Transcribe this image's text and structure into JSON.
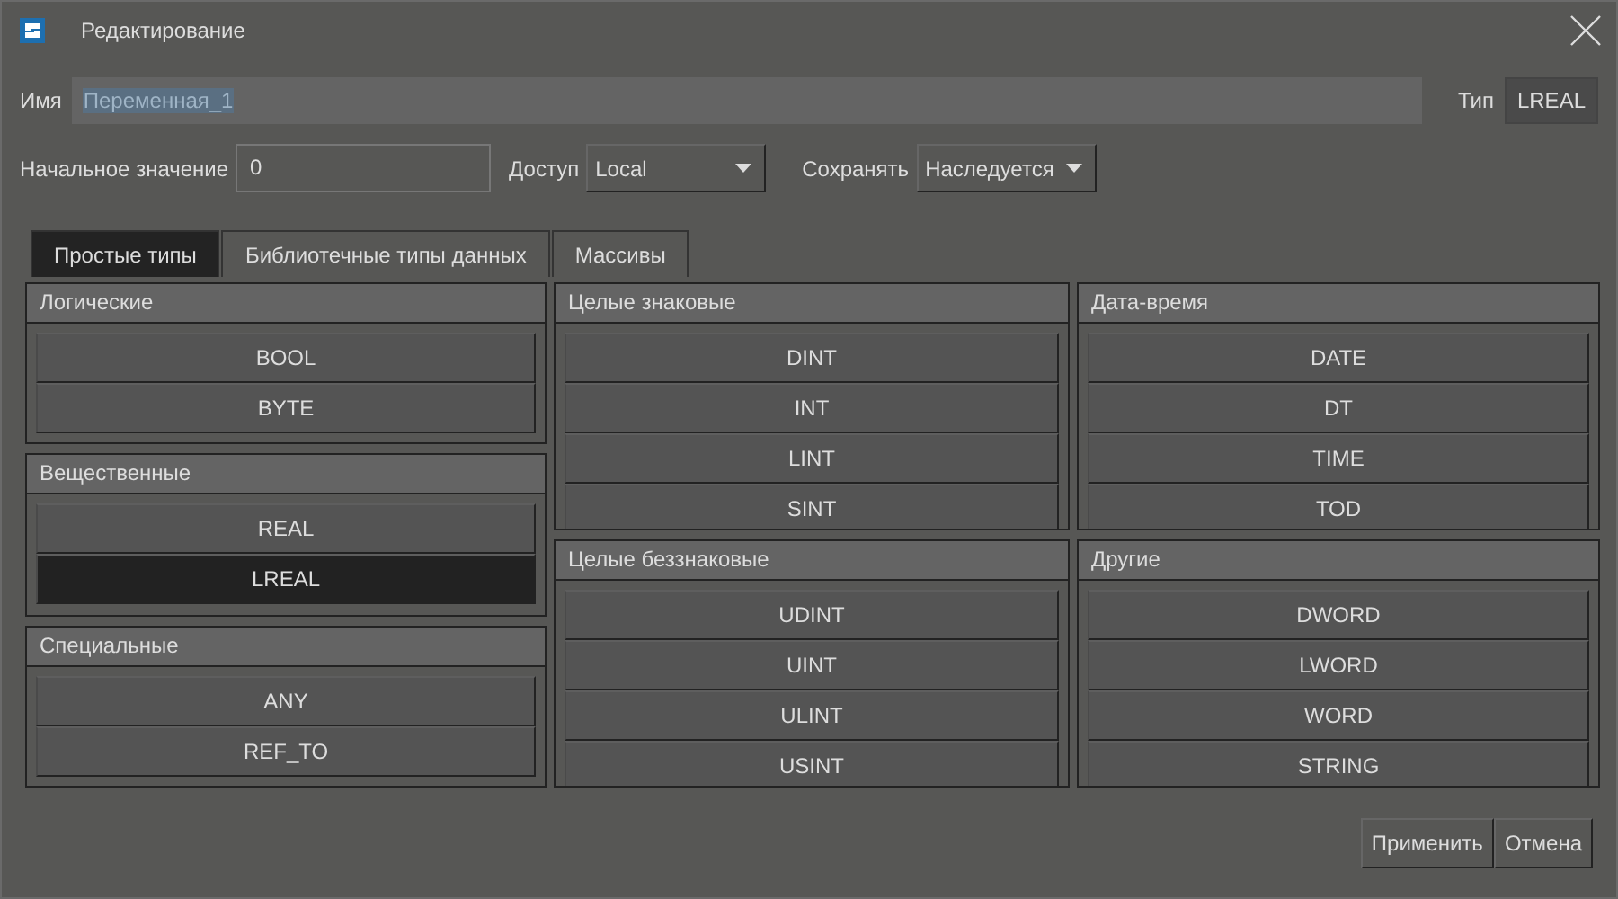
{
  "window": {
    "title": "Редактирование"
  },
  "name": {
    "label": "Имя",
    "value": "Переменная_1",
    "selected_text": true
  },
  "type": {
    "label": "Тип",
    "value": "LREAL"
  },
  "initial_value": {
    "label": "Начальное значение",
    "value": "0"
  },
  "access": {
    "label": "Доступ",
    "value": "Local"
  },
  "retain": {
    "label": "Сохранять",
    "value": "Наследуется"
  },
  "tabs": [
    {
      "label": "Простые типы",
      "selected": true
    },
    {
      "label": "Библиотечные типы данных",
      "selected": false
    },
    {
      "label": "Массивы",
      "selected": false
    }
  ],
  "columns": [
    [
      {
        "title": "Логические",
        "items": [
          {
            "label": "BOOL",
            "selected": false
          },
          {
            "label": "BYTE",
            "selected": false
          }
        ]
      },
      {
        "title": "Вещественные",
        "items": [
          {
            "label": "REAL",
            "selected": false
          },
          {
            "label": "LREAL",
            "selected": true
          }
        ]
      },
      {
        "title": "Специальные",
        "items": [
          {
            "label": "ANY",
            "selected": false
          },
          {
            "label": "REF_TO",
            "selected": false
          }
        ]
      }
    ],
    [
      {
        "title": "Целые знаковые",
        "items": [
          {
            "label": "DINT",
            "selected": false
          },
          {
            "label": "INT",
            "selected": false
          },
          {
            "label": "LINT",
            "selected": false
          },
          {
            "label": "SINT",
            "selected": false
          }
        ]
      },
      {
        "title": "Целые беззнаковые",
        "items": [
          {
            "label": "UDINT",
            "selected": false
          },
          {
            "label": "UINT",
            "selected": false
          },
          {
            "label": "ULINT",
            "selected": false
          },
          {
            "label": "USINT",
            "selected": false
          }
        ]
      }
    ],
    [
      {
        "title": "Дата-время",
        "items": [
          {
            "label": "DATE",
            "selected": false
          },
          {
            "label": "DT",
            "selected": false
          },
          {
            "label": "TIME",
            "selected": false
          },
          {
            "label": "TOD",
            "selected": false
          }
        ]
      },
      {
        "title": "Другие",
        "items": [
          {
            "label": "DWORD",
            "selected": false
          },
          {
            "label": "LWORD",
            "selected": false
          },
          {
            "label": "WORD",
            "selected": false
          },
          {
            "label": "STRING",
            "selected": false
          }
        ]
      }
    ]
  ],
  "buttons": [
    "Применить",
    "Отмена"
  ]
}
